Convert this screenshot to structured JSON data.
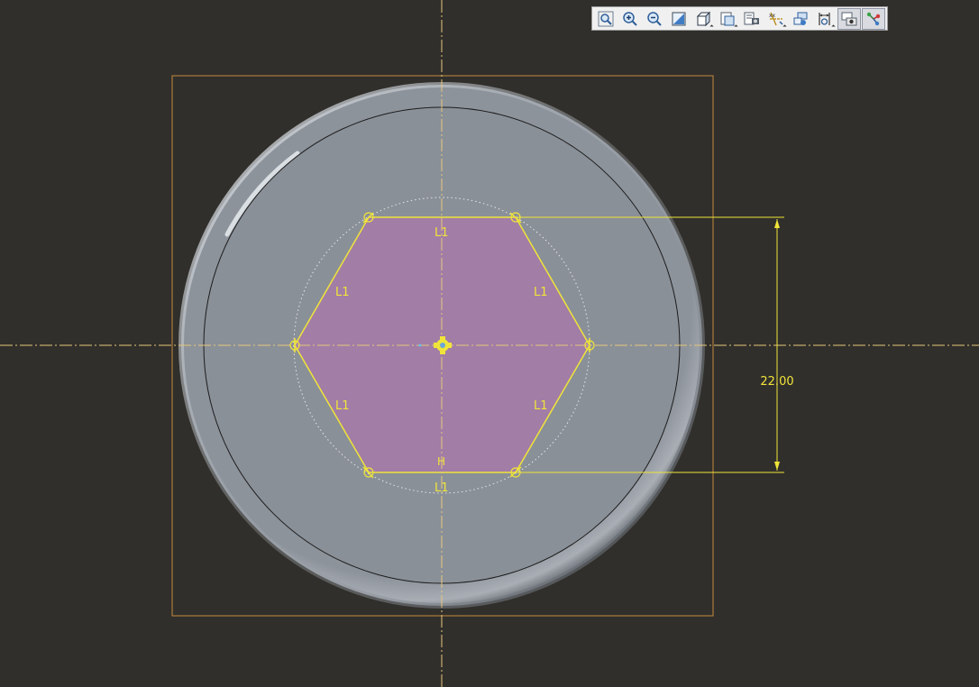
{
  "toolbar": {
    "buttons": [
      {
        "name": "refit-icon",
        "label": "Refit"
      },
      {
        "name": "zoom-in-icon",
        "label": "Zoom In"
      },
      {
        "name": "zoom-out-icon",
        "label": "Zoom Out"
      },
      {
        "name": "repaint-icon",
        "label": "Repaint"
      },
      {
        "name": "display-style-icon",
        "label": "Display Style"
      },
      {
        "name": "saved-orientations-icon",
        "label": "Saved Orientations"
      },
      {
        "name": "view-manager-icon",
        "label": "View Manager"
      },
      {
        "name": "datum-display-icon",
        "label": "Datum Display Filters"
      },
      {
        "name": "annotation-display-icon",
        "label": "Annotation Display"
      },
      {
        "name": "sketcher-display-icon",
        "label": "Sketcher Display Filters"
      },
      {
        "name": "sketch-view-icon",
        "label": "Sketch View"
      },
      {
        "name": "spin-center-icon",
        "label": "Spin Center"
      }
    ]
  },
  "sketch": {
    "dimension_value": "22.00",
    "constraint_labels": [
      "L1",
      "L1",
      "L1",
      "L1",
      "L1",
      "L1"
    ],
    "horizontal_label": "H",
    "colors": {
      "background": "#312f2b",
      "part_fill": "#8a9098",
      "sketch_fill": "#a27da6",
      "sketch_line": "#f0e43a",
      "centerline": "#e5c77b",
      "bounding_box": "#c48a3c"
    }
  }
}
